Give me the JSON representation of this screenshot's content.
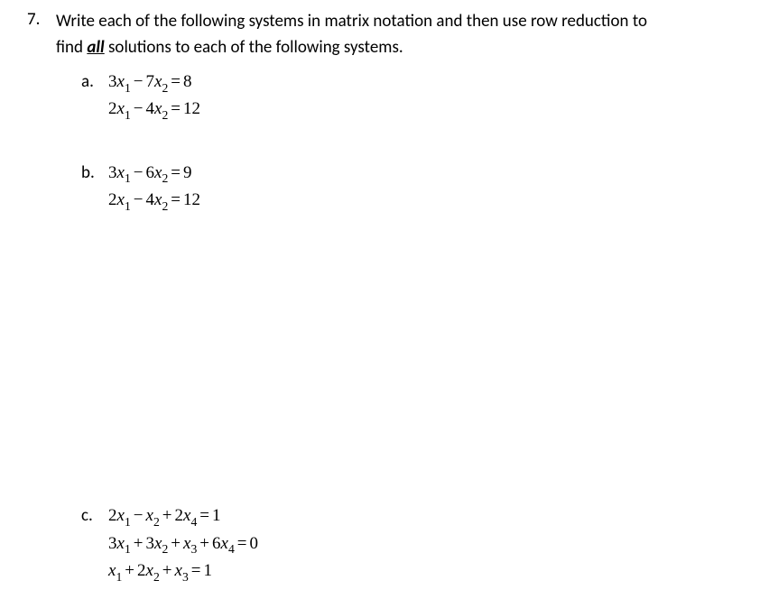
{
  "question": {
    "number": "7.",
    "text_part1": "Write each of the following systems in matrix notation and then use row reduction to",
    "text_part2_prefix": "find ",
    "text_part2_underlined": "all",
    "text_part2_suffix": " solutions to each of the following systems."
  },
  "parts": {
    "a": {
      "label": "a.",
      "equations": [
        "3x₁ − 7x₂ = 8",
        "2x₁ − 4x₂ = 12"
      ],
      "eq1": {
        "c1": "3",
        "v1": "x",
        "s1": "1",
        "op1": "−",
        "c2": "7",
        "v2": "x",
        "s2": "2",
        "eq": "=",
        "rhs": "8"
      },
      "eq2": {
        "c1": "2",
        "v1": "x",
        "s1": "1",
        "op1": "−",
        "c2": "4",
        "v2": "x",
        "s2": "2",
        "eq": "=",
        "rhs": "12"
      }
    },
    "b": {
      "label": "b.",
      "equations": [
        "3x₁ − 6x₂ = 9",
        "2x₁ − 4x₂ = 12"
      ],
      "eq1": {
        "c1": "3",
        "v1": "x",
        "s1": "1",
        "op1": "−",
        "c2": "6",
        "v2": "x",
        "s2": "2",
        "eq": "=",
        "rhs": "9"
      },
      "eq2": {
        "c1": "2",
        "v1": "x",
        "s1": "1",
        "op1": "−",
        "c2": "4",
        "v2": "x",
        "s2": "2",
        "eq": "=",
        "rhs": "12"
      }
    },
    "c": {
      "label": "c.",
      "equations": [
        "2x₁ − x₂ + 2x₄ = 1",
        "3x₁ + 3x₂ + x₃ + 6x₄ = 0",
        "x₁ + 2x₂ + x₃ = 1"
      ],
      "eq1": {
        "t1c": "2",
        "t1v": "x",
        "t1s": "1",
        "op1": "−",
        "t2c": "",
        "t2v": "x",
        "t2s": "2",
        "op2": "+",
        "t3c": "2",
        "t3v": "x",
        "t3s": "4",
        "eq": "=",
        "rhs": "1"
      },
      "eq2": {
        "t1c": "3",
        "t1v": "x",
        "t1s": "1",
        "op1": "+",
        "t2c": "3",
        "t2v": "x",
        "t2s": "2",
        "op2": "+",
        "t3c": "",
        "t3v": "x",
        "t3s": "3",
        "op3": "+",
        "t4c": "6",
        "t4v": "x",
        "t4s": "4",
        "eq": "=",
        "rhs": "0"
      },
      "eq3": {
        "t1c": "",
        "t1v": "x",
        "t1s": "1",
        "op1": "+",
        "t2c": "2",
        "t2v": "x",
        "t2s": "2",
        "op2": "+",
        "t3c": "",
        "t3v": "x",
        "t3s": "3",
        "eq": "=",
        "rhs": "1"
      }
    }
  }
}
